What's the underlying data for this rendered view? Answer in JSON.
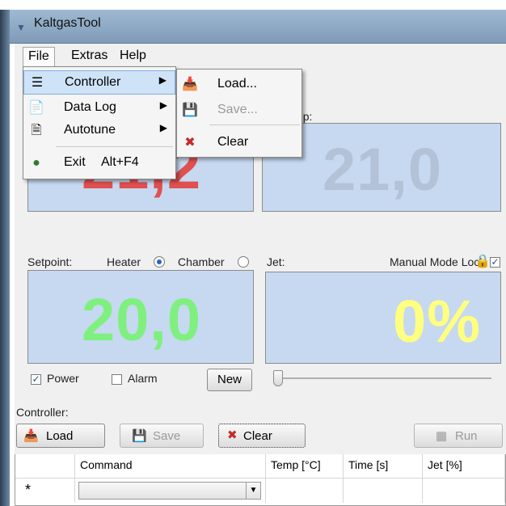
{
  "window": {
    "title": "KaltgasTool"
  },
  "menubar": {
    "file": "File",
    "extras": "Extras",
    "help": "Help"
  },
  "file_menu": {
    "controller": "Controller",
    "data_log": "Data Log",
    "autotune": "Autotune",
    "exit": "Exit",
    "exit_shortcut": "Alt+F4"
  },
  "controller_submenu": {
    "load": "Load...",
    "save": "Save...",
    "clear": "Clear"
  },
  "temps": {
    "heater_label_partial": "",
    "chamber_label_partial": "r Temp:",
    "heater_value_partial": "21,2",
    "chamber_value": "21,0"
  },
  "setpoint": {
    "label": "Setpoint:",
    "heater_label": "Heater",
    "chamber_label": "Chamber",
    "value": "20,0",
    "selected": "Heater"
  },
  "jet": {
    "label": "Jet:",
    "manual_mode_lock_label": "Manual Mode Lock",
    "manual_mode_lock_checked": true,
    "value": "0%",
    "slider_fraction": 0.0
  },
  "options": {
    "power_label": "Power",
    "power_checked": true,
    "alarm_label": "Alarm",
    "alarm_checked": false,
    "new_button": "New"
  },
  "controller_section": {
    "label": "Controller:",
    "load_button": "Load",
    "save_button": "Save",
    "clear_button": "Clear",
    "run_button": "Run"
  },
  "grid": {
    "columns": [
      "",
      "Command",
      "Temp [°C]",
      "Time [s]",
      "Jet [%]"
    ],
    "new_row_marker": "*"
  },
  "colors": {
    "panel_bg": "#c6d9f0",
    "heater_temp": "#e05050",
    "chamber_temp": "#b3c2d6",
    "setpoint_value": "#7ff07f",
    "jet_value": "#ffff80",
    "menu_highlight": "#cfe3f8"
  }
}
